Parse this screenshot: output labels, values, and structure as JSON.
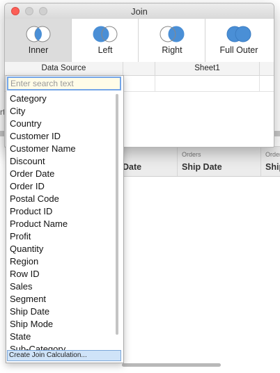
{
  "dialog": {
    "title": "Join",
    "join_types": [
      {
        "label": "Inner",
        "icon": "venn-inner-icon",
        "selected": true
      },
      {
        "label": "Left",
        "icon": "venn-left-icon",
        "selected": false
      },
      {
        "label": "Right",
        "icon": "venn-right-icon",
        "selected": false
      },
      {
        "label": "Full Outer",
        "icon": "venn-full-outer-icon",
        "selected": false
      }
    ],
    "clause_header": {
      "left": "Data Source",
      "right": "Sheet1"
    }
  },
  "dropdown": {
    "search_placeholder": "Enter search text",
    "fields": [
      "Category",
      "City",
      "Country",
      "Customer ID",
      "Customer Name",
      "Discount",
      "Order Date",
      "Order ID",
      "Postal Code",
      "Product ID",
      "Product Name",
      "Profit",
      "Quantity",
      "Region",
      "Row ID",
      "Sales",
      "Segment",
      "Ship Date",
      "Ship Mode",
      "State",
      "Sub-Category"
    ],
    "calc_label": "Create Join Calculation..."
  },
  "background": {
    "left_fragment": "rt",
    "columns": [
      {
        "source": "",
        "name": "Date"
      },
      {
        "source": "Orders",
        "name": "Ship Date"
      },
      {
        "source": "Order",
        "name": "Ship"
      }
    ]
  },
  "colors": {
    "venn_blue": "#4a8fd6",
    "selected_bg": "#dcdcdc",
    "search_focus": "#74a6e8"
  }
}
